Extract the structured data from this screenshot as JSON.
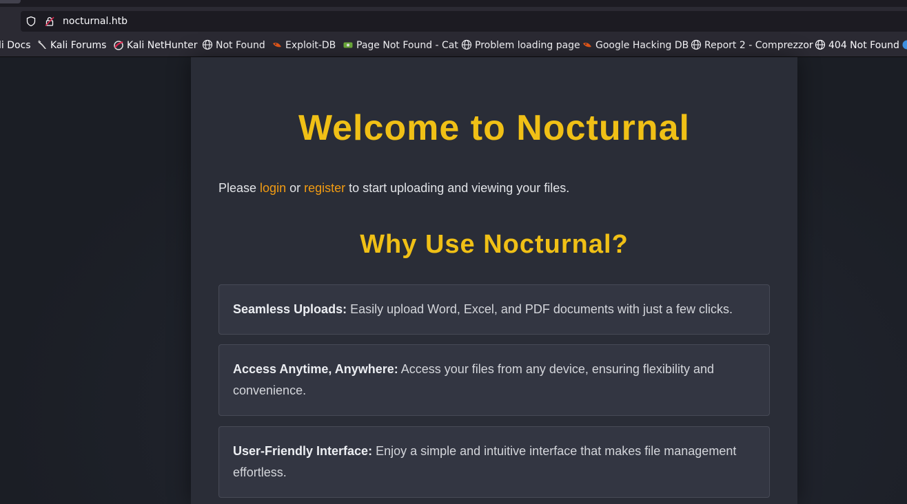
{
  "browser": {
    "url": "nocturnal.htb",
    "bookmarks": [
      {
        "label": "li Docs",
        "icon": "kali-docs-icon"
      },
      {
        "label": "Kali Forums",
        "icon": "kali-dragon-icon"
      },
      {
        "label": "Kali NetHunter",
        "icon": "nethunter-icon"
      },
      {
        "label": "Not Found",
        "icon": "globe-icon"
      },
      {
        "label": "Exploit-DB",
        "icon": "exploitdb-icon"
      },
      {
        "label": "Page Not Found - Cat",
        "icon": "cat-icon"
      },
      {
        "label": "Problem loading page",
        "icon": "globe-icon"
      },
      {
        "label": "Google Hacking DB",
        "icon": "exploitdb-icon"
      },
      {
        "label": "Report 2 - Comprezzor",
        "icon": "globe-icon"
      },
      {
        "label": "404 Not Found",
        "icon": "globe-icon"
      }
    ]
  },
  "page": {
    "title": "Welcome to Nocturnal",
    "intro": {
      "before": "Please ",
      "login": "login",
      "middle": " or ",
      "register": "register",
      "after": " to start uploading and viewing your files."
    },
    "subtitle": "Why Use Nocturnal?",
    "features": [
      {
        "heading": "Seamless Uploads:",
        "text": " Easily upload Word, Excel, and PDF documents with just a few clicks."
      },
      {
        "heading": "Access Anytime, Anywhere:",
        "text": " Access your files from any device, ensuring flexibility and convenience."
      },
      {
        "heading": "User-Friendly Interface:",
        "text": " Enjoy a simple and intuitive interface that makes file management effortless."
      }
    ]
  },
  "colors": {
    "accent": "#f0c016",
    "link": "#f39c12",
    "background": "#1c1f26",
    "card": "#2a2d37"
  }
}
